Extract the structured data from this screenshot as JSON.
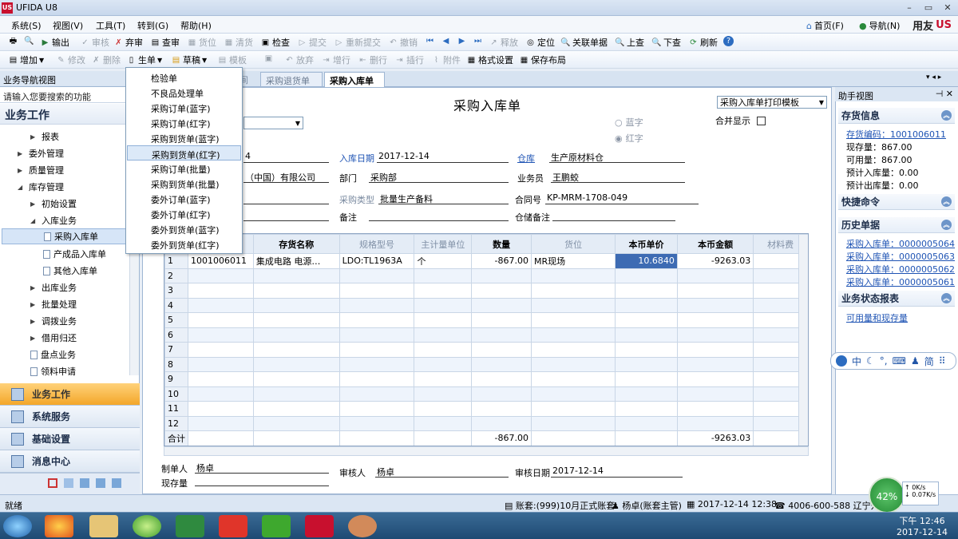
{
  "app": {
    "title": "UFIDA U8",
    "logo": "US"
  },
  "window_controls": [
    "–",
    "▭",
    "✕"
  ],
  "menubar": {
    "items": [
      "系统(S)",
      "视图(V)",
      "工具(T)",
      "转到(G)",
      "帮助(H)"
    ],
    "right": {
      "home": "首页(F)",
      "nav": "导航(N)",
      "brand": "用友"
    }
  },
  "toolbar1": {
    "items": [
      "输出",
      "审核",
      "弃审",
      "查审",
      "货位",
      "清货",
      "检查",
      "提交",
      "重新提交",
      "撤销",
      "释放",
      "定位",
      "关联单据",
      "上查",
      "下查",
      "刷新"
    ]
  },
  "toolbar2": {
    "items": [
      "增加",
      "修改",
      "删除",
      "生单",
      "草稿",
      "模板",
      "放弃",
      "增行",
      "删行",
      "插行",
      "附件",
      "格式设置",
      "保存布局"
    ]
  },
  "tabs": {
    "items": [
      "间",
      "采购退货单",
      "采购入库单"
    ]
  },
  "left_panel": {
    "title": "业务导航视图",
    "search_placeholder": "请输入您要搜索的功能",
    "section": "业务工作",
    "tree": [
      "报表",
      "委外管理",
      "质量管理",
      "库存管理",
      "初始设置",
      "入库业务",
      "采购入库单",
      "产成品入库单",
      "其他入库单",
      "出库业务",
      "批量处理",
      "调拨业务",
      "借用归还",
      "盘点业务",
      "领料申请"
    ],
    "nav_buttons": [
      "业务工作",
      "系统服务",
      "基础设置",
      "消息中心"
    ]
  },
  "dropdown": {
    "items": [
      "检验单",
      "不良品处理单",
      "采购订单(蓝字)",
      "采购订单(红字)",
      "采购到货单(蓝字)",
      "采购到货单(红字)",
      "采购订单(批量)",
      "采购到货单(批量)",
      "委外订单(蓝字)",
      "委外订单(红字)",
      "委外到货单(蓝字)",
      "委外到货单(红字)"
    ],
    "active_index": 5
  },
  "form": {
    "title": "采购入库单",
    "print_template": "采购入库单打印模板",
    "blue": "蓝字",
    "red": "红字",
    "merge_display": "合并显示",
    "fields": {
      "code_tail": "4",
      "date_label": "入库日期",
      "date": "2017-12-14",
      "warehouse_label": "仓库",
      "warehouse": "生产原材料仓",
      "supplier_tail": "（中国）有限公司",
      "dept_label": "部门",
      "dept": "采购部",
      "staff_label": "业务员",
      "staff": "王鹏蛟",
      "ptype_label": "采购类型",
      "ptype": "批量生产备料",
      "contract_label": "合同号",
      "contract": "KP-MRM-1708-049",
      "remark_label": "备注",
      "remark": "",
      "wh_remark_label": "仓储备注",
      "wh_remark": ""
    },
    "columns": [
      "",
      "",
      "存货名称",
      "规格型号",
      "主计量单位",
      "数量",
      "货位",
      "本币单价",
      "本币金额",
      "材料费"
    ],
    "rows": [
      {
        "n": "1",
        "code": "1001006011",
        "name": "集成电路 电源…",
        "spec": "LDO:TL1963A",
        "unit": "个",
        "qty": "-867.00",
        "loc": "MR现场",
        "price": "10.6840",
        "amount": "-9263.03"
      },
      {
        "n": "2"
      },
      {
        "n": "3"
      },
      {
        "n": "4"
      },
      {
        "n": "5"
      },
      {
        "n": "6"
      },
      {
        "n": "7"
      },
      {
        "n": "8"
      },
      {
        "n": "9"
      },
      {
        "n": "10"
      },
      {
        "n": "11"
      },
      {
        "n": "12"
      }
    ],
    "total": {
      "label": "合计",
      "qty": "-867.00",
      "amount": "-9263.03"
    },
    "footer": {
      "maker_label": "制单人",
      "maker": "杨卓",
      "auditor_label": "审核人",
      "auditor": "杨卓",
      "audit_date_label": "审核日期",
      "audit_date": "2017-12-14",
      "stock_label": "现存量",
      "stock": ""
    }
  },
  "right_panel": {
    "title": "助手视图",
    "inventory_title": "存货信息",
    "inventory_code_link": "存货编码：1001006011",
    "lines": [
      "现存量：867.00",
      "可用量：867.00",
      "预计入库量：0.00",
      "预计出库量：0.00"
    ],
    "shortcut_title": "快捷命令",
    "history_title": "历史单据",
    "history": [
      "采购入库单：0000005064",
      "采购入库单：0000005063",
      "采购入库单：0000005062",
      "采购入库单：0000005061"
    ],
    "report_title": "业务状态报表",
    "report_link": "可用量和现存量"
  },
  "ime": {
    "items": [
      "中",
      "简"
    ]
  },
  "network": {
    "percent": "42%",
    "up": "0K/s",
    "down": "0.07K/s"
  },
  "statusbar": {
    "left": "就绪",
    "account": "账套:(999)10月正式账套",
    "user": "杨卓(账套主管)",
    "datetime": "2017-12-14 12:38",
    "phone": "4006-600-588 辽宁开…"
  },
  "clock": {
    "time": "下午 12:46",
    "date": "2017-12-14"
  }
}
